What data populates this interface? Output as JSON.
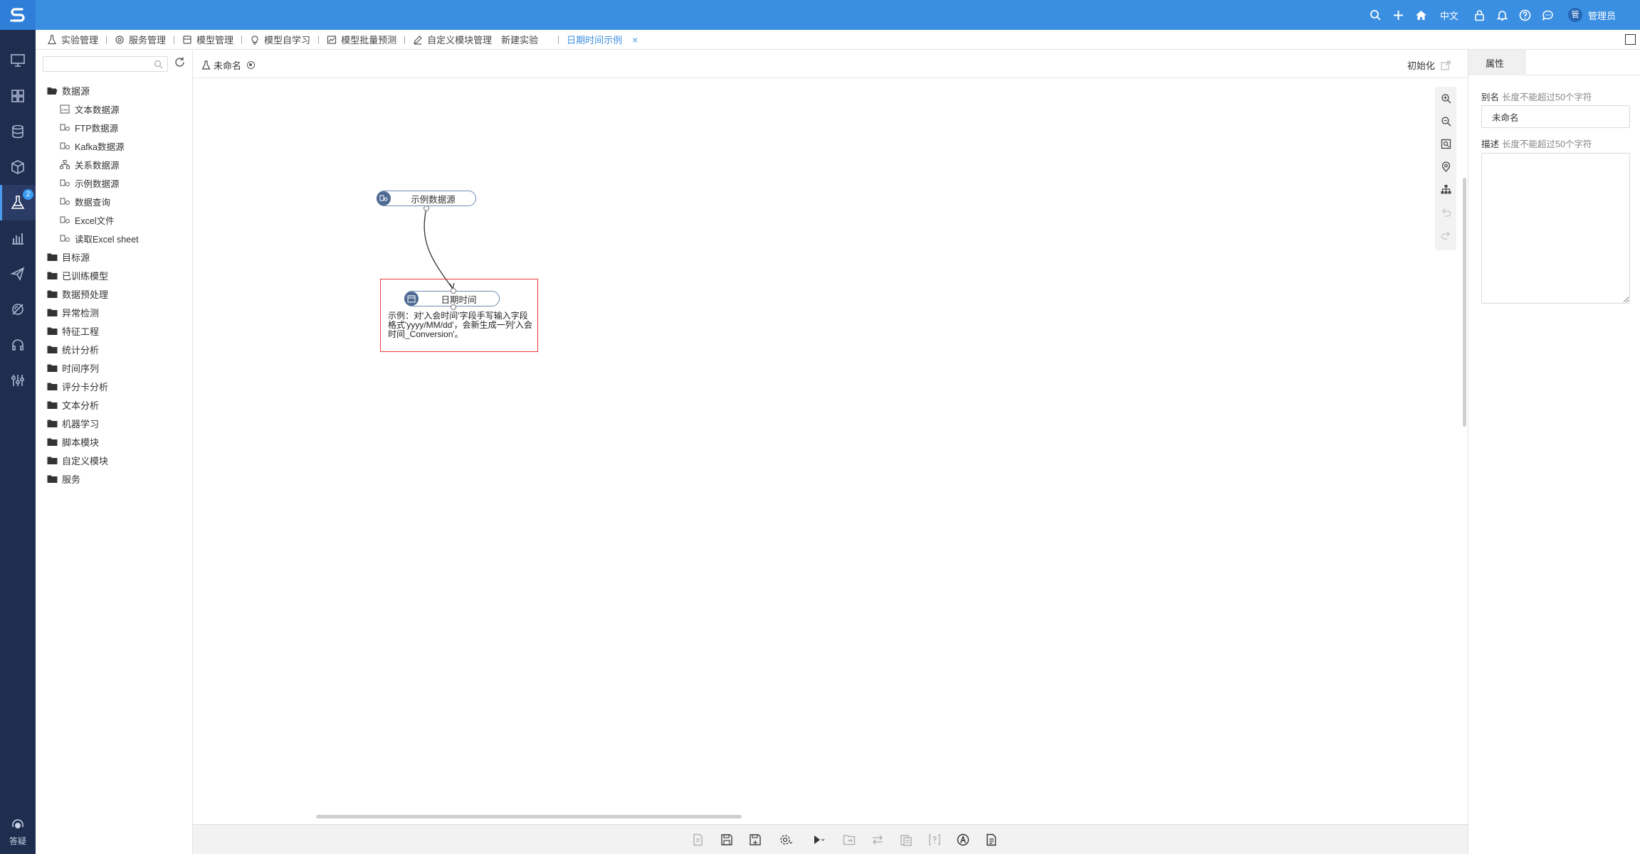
{
  "header": {
    "language": "中文",
    "avatar_text": "管",
    "username": "管理员"
  },
  "rail": {
    "badge": "2",
    "help_label": "答疑"
  },
  "tabs": [
    {
      "label": "实验管理",
      "icon": "flask-icon"
    },
    {
      "label": "服务管理",
      "icon": "service-icon"
    },
    {
      "label": "模型管理",
      "icon": "model-icon"
    },
    {
      "label": "模型自学习",
      "icon": "bulb-icon"
    },
    {
      "label": "模型批量预测",
      "icon": "chart-image-icon"
    },
    {
      "label": "自定义模块管理",
      "icon": "edit-icon"
    },
    {
      "label": "新建实验",
      "icon": ""
    },
    {
      "label": "日期时间示例",
      "icon": "",
      "active": true,
      "close": "×"
    }
  ],
  "tree": {
    "search_placeholder": "",
    "items": [
      {
        "label": "数据源",
        "type": "folder-open"
      },
      {
        "label": "文本数据源",
        "type": "child",
        "icon": "csv-icon"
      },
      {
        "label": "FTP数据源",
        "type": "child",
        "icon": "datasource-icon"
      },
      {
        "label": "Kafka数据源",
        "type": "child",
        "icon": "datasource-icon"
      },
      {
        "label": "关系数据源",
        "type": "child",
        "icon": "relation-icon"
      },
      {
        "label": "示例数据源",
        "type": "child",
        "icon": "datasource-icon"
      },
      {
        "label": "数据查询",
        "type": "child",
        "icon": "datasource-icon"
      },
      {
        "label": "Excel文件",
        "type": "child",
        "icon": "datasource-icon"
      },
      {
        "label": "读取Excel sheet",
        "type": "child",
        "icon": "datasource-icon"
      },
      {
        "label": "目标源",
        "type": "folder"
      },
      {
        "label": "已训练模型",
        "type": "folder"
      },
      {
        "label": "数据预处理",
        "type": "folder"
      },
      {
        "label": "异常检测",
        "type": "folder"
      },
      {
        "label": "特征工程",
        "type": "folder"
      },
      {
        "label": "统计分析",
        "type": "folder"
      },
      {
        "label": "时间序列",
        "type": "folder"
      },
      {
        "label": "评分卡分析",
        "type": "folder"
      },
      {
        "label": "文本分析",
        "type": "folder"
      },
      {
        "label": "机器学习",
        "type": "folder"
      },
      {
        "label": "脚本模块",
        "type": "folder"
      },
      {
        "label": "自定义模块",
        "type": "folder"
      },
      {
        "label": "服务",
        "type": "folder"
      }
    ]
  },
  "canvas": {
    "experiment_name": "未命名",
    "init_label": "初始化",
    "nodes": {
      "source": "示例数据源",
      "datetime": "日期时间"
    },
    "annotation": "示例：对'入会时间'字段手写输入字段格式'yyyy/MM/dd'，会新生成一列'入会时间_Conversion'。"
  },
  "properties": {
    "tab": "属性",
    "alias_label": "别名",
    "alias_hint": "长度不能超过50个字符",
    "alias_value": "未命名",
    "desc_label": "描述",
    "desc_hint": "长度不能超过50个字符"
  },
  "colors": {
    "header": "#3b8fe2",
    "rail": "#1f2d4f",
    "annotation_border": "#e23b3b"
  }
}
